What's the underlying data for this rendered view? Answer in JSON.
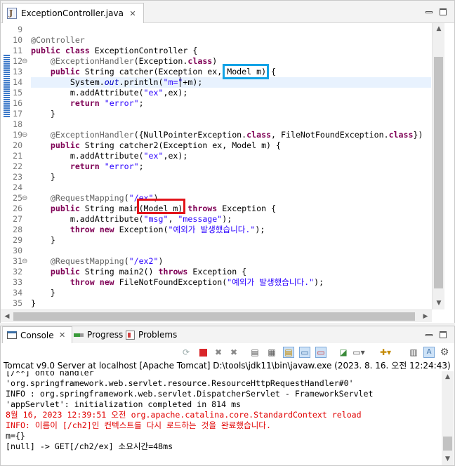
{
  "editor": {
    "tab_title": "ExceptionController.java",
    "close_glyph": "✕",
    "lines": [
      {
        "n": "9",
        "fold": "",
        "segments": [
          {
            "t": ""
          }
        ]
      },
      {
        "n": "10",
        "fold": "",
        "segments": [
          {
            "t": "@Controller",
            "c": "ann"
          }
        ]
      },
      {
        "n": "11",
        "fold": "",
        "segments": [
          {
            "t": "public class ",
            "c": "kw"
          },
          {
            "t": "ExceptionController {"
          }
        ]
      },
      {
        "n": "12",
        "fold": "⊖",
        "segments": [
          {
            "t": "    "
          },
          {
            "t": "@ExceptionHandler",
            "c": "ann"
          },
          {
            "t": "(Exception."
          },
          {
            "t": "class",
            "c": "kw"
          },
          {
            "t": ")"
          }
        ]
      },
      {
        "n": "13",
        "fold": "",
        "segments": [
          {
            "t": "    "
          },
          {
            "t": "public ",
            "c": "kw"
          },
          {
            "t": "String catcher(Exception ex, Model m) {"
          }
        ]
      },
      {
        "n": "14",
        "fold": "",
        "current": true,
        "segments": [
          {
            "t": "        System."
          },
          {
            "t": "out",
            "c": "it"
          },
          {
            "t": ".println("
          },
          {
            "t": "\"m=\"",
            "c": "str"
          },
          {
            "t": "+m);"
          }
        ]
      },
      {
        "n": "15",
        "fold": "",
        "segments": [
          {
            "t": "        m.addAttribute("
          },
          {
            "t": "\"ex\"",
            "c": "str"
          },
          {
            "t": ",ex);"
          }
        ]
      },
      {
        "n": "16",
        "fold": "",
        "segments": [
          {
            "t": "        "
          },
          {
            "t": "return ",
            "c": "kw"
          },
          {
            "t": "\"error\"",
            "c": "str"
          },
          {
            "t": ";"
          }
        ]
      },
      {
        "n": "17",
        "fold": "",
        "segments": [
          {
            "t": "    }"
          }
        ]
      },
      {
        "n": "18",
        "fold": "",
        "segments": [
          {
            "t": ""
          }
        ]
      },
      {
        "n": "19",
        "fold": "⊖",
        "segments": [
          {
            "t": "    "
          },
          {
            "t": "@ExceptionHandler",
            "c": "ann"
          },
          {
            "t": "({NullPointerException."
          },
          {
            "t": "class",
            "c": "kw"
          },
          {
            "t": ", FileNotFoundException."
          },
          {
            "t": "class",
            "c": "kw"
          },
          {
            "t": "})"
          }
        ]
      },
      {
        "n": "20",
        "fold": "",
        "segments": [
          {
            "t": "    "
          },
          {
            "t": "public ",
            "c": "kw"
          },
          {
            "t": "String catcher2(Exception ex, Model m) {"
          }
        ]
      },
      {
        "n": "21",
        "fold": "",
        "segments": [
          {
            "t": "        m.addAttribute("
          },
          {
            "t": "\"ex\"",
            "c": "str"
          },
          {
            "t": ",ex);"
          }
        ]
      },
      {
        "n": "22",
        "fold": "",
        "segments": [
          {
            "t": "        "
          },
          {
            "t": "return ",
            "c": "kw"
          },
          {
            "t": "\"error\"",
            "c": "str"
          },
          {
            "t": ";"
          }
        ]
      },
      {
        "n": "23",
        "fold": "",
        "segments": [
          {
            "t": "    }"
          }
        ]
      },
      {
        "n": "24",
        "fold": "",
        "segments": [
          {
            "t": ""
          }
        ]
      },
      {
        "n": "25",
        "fold": "⊖",
        "segments": [
          {
            "t": "    "
          },
          {
            "t": "@RequestMapping",
            "c": "ann"
          },
          {
            "t": "("
          },
          {
            "t": "\"/ex\"",
            "c": "str"
          },
          {
            "t": ")"
          }
        ]
      },
      {
        "n": "26",
        "fold": "",
        "segments": [
          {
            "t": "    "
          },
          {
            "t": "public ",
            "c": "kw"
          },
          {
            "t": "String main(Model m) "
          },
          {
            "t": "throws ",
            "c": "kw"
          },
          {
            "t": "Exception {"
          }
        ]
      },
      {
        "n": "27",
        "fold": "",
        "segments": [
          {
            "t": "        m.addAttribute("
          },
          {
            "t": "\"msg\"",
            "c": "str"
          },
          {
            "t": ", "
          },
          {
            "t": "\"message\"",
            "c": "str"
          },
          {
            "t": ");"
          }
        ]
      },
      {
        "n": "28",
        "fold": "",
        "segments": [
          {
            "t": "        "
          },
          {
            "t": "throw new ",
            "c": "kw"
          },
          {
            "t": "Exception("
          },
          {
            "t": "\"예외가 발생했습니다.\"",
            "c": "str"
          },
          {
            "t": ");"
          }
        ]
      },
      {
        "n": "29",
        "fold": "",
        "segments": [
          {
            "t": "    }"
          }
        ]
      },
      {
        "n": "30",
        "fold": "",
        "segments": [
          {
            "t": ""
          }
        ]
      },
      {
        "n": "31",
        "fold": "⊖",
        "segments": [
          {
            "t": "    "
          },
          {
            "t": "@RequestMapping",
            "c": "ann"
          },
          {
            "t": "("
          },
          {
            "t": "\"/ex2\"",
            "c": "str"
          },
          {
            "t": ")"
          }
        ]
      },
      {
        "n": "32",
        "fold": "",
        "segments": [
          {
            "t": "    "
          },
          {
            "t": "public ",
            "c": "kw"
          },
          {
            "t": "String main2() "
          },
          {
            "t": "throws ",
            "c": "kw"
          },
          {
            "t": "Exception {"
          }
        ]
      },
      {
        "n": "33",
        "fold": "",
        "segments": [
          {
            "t": "        "
          },
          {
            "t": "throw new ",
            "c": "kw"
          },
          {
            "t": "FileNotFoundException("
          },
          {
            "t": "\"예외가 발생했습니다.\"",
            "c": "str"
          },
          {
            "t": ");"
          }
        ]
      },
      {
        "n": "34",
        "fold": "",
        "segments": [
          {
            "t": "    }"
          }
        ]
      },
      {
        "n": "35",
        "fold": "",
        "segments": [
          {
            "t": "}"
          }
        ]
      }
    ],
    "highlight_colors": {
      "blue": "#13a3e6",
      "red": "#e3141b"
    }
  },
  "console": {
    "tabs": [
      {
        "label": "Console",
        "icon": "console-icon"
      },
      {
        "label": "Progress",
        "icon": "progress-icon"
      },
      {
        "label": "Problems",
        "icon": "problems-icon"
      }
    ],
    "title": "Tomcat v9.0 Server at localhost [Apache Tomcat] D:\\tools\\jdk11\\bin\\javaw.exe  (2023. 8. 16. 오전 12:24:43)",
    "lines": [
      {
        "text": "[/**] onto handler",
        "err": false
      },
      {
        "text": "'org.springframework.web.servlet.resource.ResourceHttpRequestHandler#0'",
        "err": false
      },
      {
        "text": "INFO : org.springframework.web.servlet.DispatcherServlet - FrameworkServlet",
        "err": false
      },
      {
        "text": "'appServlet': initialization completed in 814 ms",
        "err": false
      },
      {
        "text": "8월 16, 2023 12:39:51 오전 org.apache.catalina.core.StandardContext reload",
        "err": true
      },
      {
        "text": "INFO: 이름이 [/ch2]인 컨텍스트를 다시 로드하는 것을 완료했습니다.",
        "err": true
      },
      {
        "text": "m={}",
        "err": false
      },
      {
        "text": "[null] -> GET[/ch2/ex] 소요시간=48ms",
        "err": false
      }
    ]
  },
  "colors": {
    "keyword": "#7f0055",
    "annotation": "#646464",
    "string": "#2a00ff",
    "field": "#0000c0",
    "console_error": "#e00000",
    "current_line": "#e8f2fe"
  }
}
